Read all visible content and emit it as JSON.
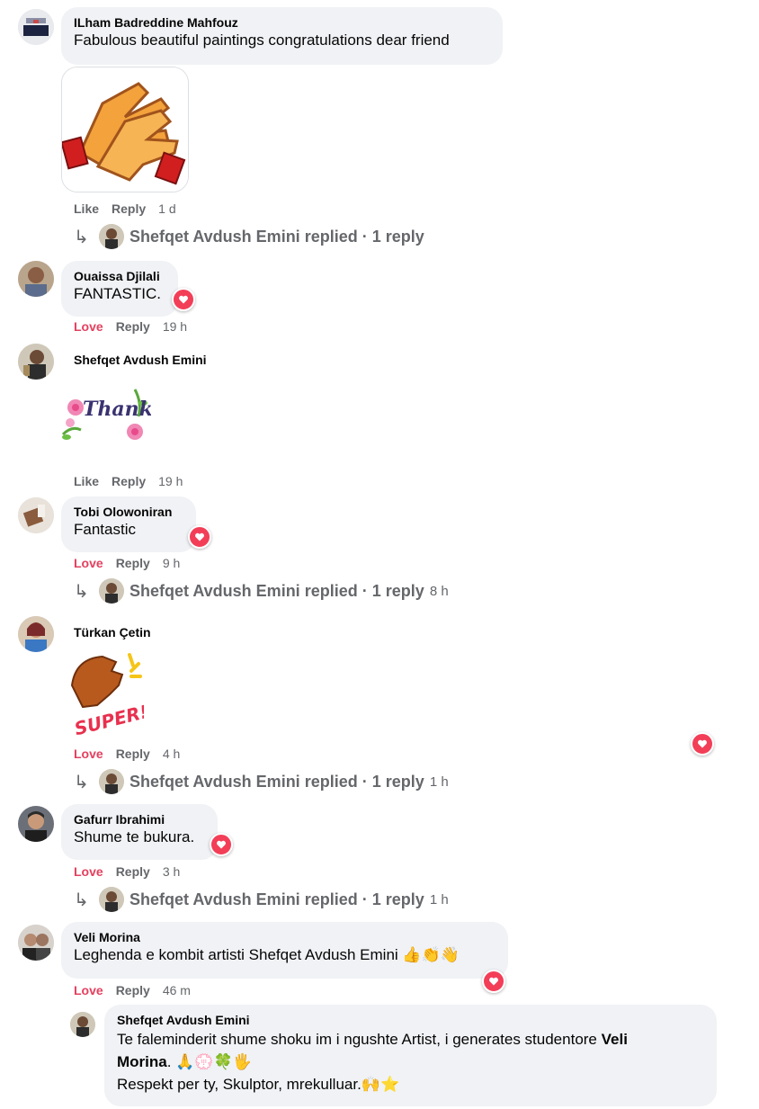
{
  "actions": {
    "like": "Like",
    "reply": "Reply",
    "love": "Love"
  },
  "comments": [
    {
      "name": "ILham Badreddine Mahfouz",
      "text": "Fabulous beautiful paintings congratulations dear friend",
      "time": "1 d",
      "reaction": "Like",
      "replies": {
        "author": "Shefqet Avdush Emini",
        "verb": "replied",
        "sep": "·",
        "count": "1 reply",
        "time": ""
      }
    },
    {
      "name": "Ouaissa Djilali",
      "text": "FANTASTIC.",
      "time": "19 h",
      "reaction": "Love"
    },
    {
      "name": "Shefqet Avdush Emini",
      "sticker_text": "Thank you",
      "time": "19 h",
      "reaction": "Like"
    },
    {
      "name": "Tobi Olowoniran",
      "text": "Fantastic",
      "time": "9 h",
      "reaction": "Love",
      "replies": {
        "author": "Shefqet Avdush Emini",
        "verb": "replied",
        "sep": "·",
        "count": "1 reply",
        "time": "8 h"
      }
    },
    {
      "name": "Türkan Çetin",
      "sticker_text": "SUPER!",
      "time": "4 h",
      "reaction": "Love",
      "replies": {
        "author": "Shefqet Avdush Emini",
        "verb": "replied",
        "sep": "·",
        "count": "1 reply",
        "time": "1 h"
      }
    },
    {
      "name": "Gafurr Ibrahimi",
      "text": "Shume te bukura.",
      "time": "3 h",
      "reaction": "Love",
      "replies": {
        "author": "Shefqet Avdush Emini",
        "verb": "replied",
        "sep": "·",
        "count": "1 reply",
        "time": "1 h"
      }
    },
    {
      "name": "Veli Morina",
      "text": "Leghenda e kombit artisti Shefqet Avdush Emini 👍👏👋",
      "time": "46 m",
      "reaction": "Love"
    }
  ],
  "nested_reply": {
    "name": "Shefqet Avdush Emini",
    "line1_pre": "Te faleminderit shume shoku im i ngushte Artist, i generates studentore ",
    "line1_bold": "Veli",
    "line2_bold": "Morina",
    "line2_post": ". 🙏💮🍀🖐",
    "line3": "Respekt per ty, Skulptor, mrekulluar.🙌⭐"
  },
  "colors": {
    "love": "#e4405f",
    "heart": "#f33e58",
    "bubble": "#f0f2f5",
    "meta": "#65676b"
  }
}
